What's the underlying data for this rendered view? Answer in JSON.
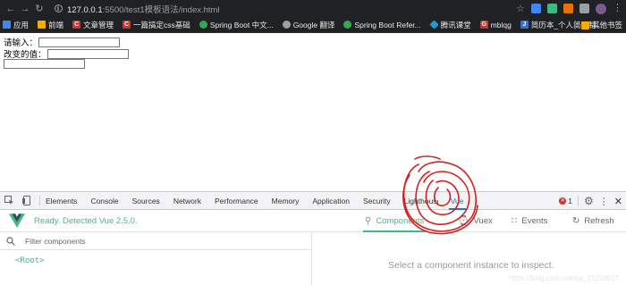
{
  "browser": {
    "url_host": "127.0.0.1",
    "url_path": ":5500/test1模板语法/index.html",
    "bookmarks": [
      "应用",
      "前端",
      "文章管理",
      "一篇搞定css基础",
      "Spring Boot 中文...",
      "Google 翻译",
      "Spring Boot Refer...",
      "腾讯课堂",
      "mblqg",
      "简历本_个人简历制..."
    ],
    "other_bookmarks": "其他书签"
  },
  "page": {
    "input_label": "请输入：",
    "changed_label": "改变的值："
  },
  "devtools": {
    "tabs": [
      "Elements",
      "Console",
      "Sources",
      "Network",
      "Performance",
      "Memory",
      "Application",
      "Security",
      "Lighthouse",
      "Vue"
    ],
    "active_tab": "Vue",
    "error_count": "1"
  },
  "vue": {
    "status": "Ready. Detected Vue 2.5.0.",
    "tabs": {
      "components": "Components",
      "vuex": "Vuex",
      "events": "Events",
      "refresh": "Refresh"
    },
    "filter_placeholder": "Filter components",
    "root_node": "<Root>",
    "hint": "Select a component instance to inspect.",
    "watermark": "https://blog.csdn.net/qq_31208917"
  },
  "colors": {
    "vue_green": "#41b883",
    "devtools_blue": "#1a73e8",
    "annotation_red": "#d32020"
  }
}
